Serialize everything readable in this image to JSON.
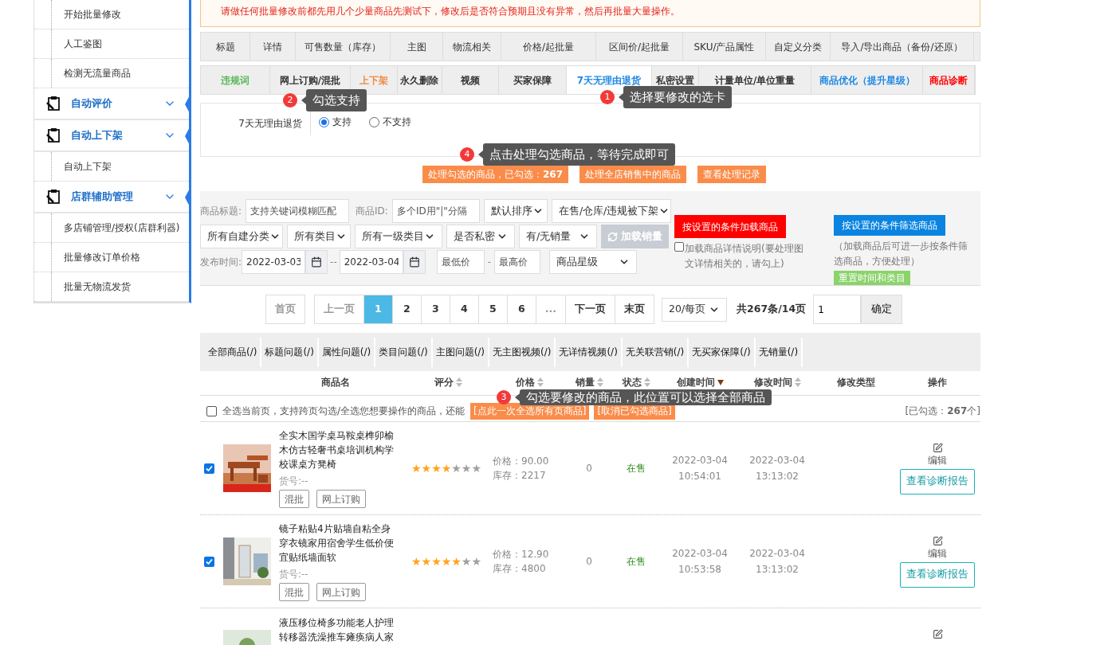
{
  "sidebar": {
    "items": [
      {
        "kind": "item",
        "label": "开始批量修改"
      },
      {
        "kind": "item",
        "label": "人工鉴图"
      },
      {
        "kind": "item",
        "label": "检测无流量商品"
      },
      {
        "kind": "group",
        "label": "自动评价"
      },
      {
        "kind": "group",
        "label": "自动上下架"
      },
      {
        "kind": "item",
        "label": "自动上下架"
      },
      {
        "kind": "group",
        "label": "店群辅助管理"
      },
      {
        "kind": "item",
        "label": "多店铺管理/授权(店群利器)"
      },
      {
        "kind": "item",
        "label": "批量修改订单价格"
      },
      {
        "kind": "item",
        "label": "批量无物流发货"
      }
    ]
  },
  "notice": "请做任何批量修改前都先用几个少量商品先测试下，修改后是否符合预期且没有异常，然后再批量大量操作。",
  "tabs_row_1": [
    {
      "label": "标题",
      "selected": false
    },
    {
      "label": "详情",
      "selected": false
    },
    {
      "label": "可售数量（库存）",
      "selected": false
    },
    {
      "label": "主图",
      "selected": false
    },
    {
      "label": "物流相关",
      "selected": false
    },
    {
      "label": "价格/起批量",
      "selected": false
    },
    {
      "label": "区间价/起批量",
      "selected": false
    },
    {
      "label": "SKU/产品属性",
      "selected": false
    },
    {
      "label": "自定义分类",
      "selected": false
    },
    {
      "label": "导入/导出商品（备份/还原）",
      "selected": false
    }
  ],
  "tabs_row_2": [
    {
      "label": "违规词",
      "selected": false,
      "color": "#5cb85c"
    },
    {
      "label": "网上订购/混批",
      "selected": false,
      "color": "#333333"
    },
    {
      "label": "上下架",
      "selected": false,
      "color": "#f0883e"
    },
    {
      "label": "永久删除",
      "selected": false,
      "color": "#333333"
    },
    {
      "label": "视频",
      "selected": false,
      "color": "#333333"
    },
    {
      "label": "买家保障",
      "selected": false,
      "color": "#333333"
    },
    {
      "label": "7天无理由退货",
      "selected": true,
      "color": "#1e88e5"
    },
    {
      "label": "私密设置",
      "selected": false,
      "color": "#333333"
    },
    {
      "label": "计量单位/单位重量",
      "selected": false,
      "color": "#333333"
    },
    {
      "label": "商品优化（提升星级）",
      "selected": false,
      "color": "#1e88e5"
    },
    {
      "label": "商品诊断",
      "selected": false,
      "color": "#ff0000"
    }
  ],
  "setting": {
    "label": "7天无理由退货",
    "options": [
      {
        "label": "支持",
        "selected": true
      },
      {
        "label": "不支持",
        "selected": false
      }
    ]
  },
  "actions": [
    "处理勾选的商品，已勾选：**267**",
    "处理全店销售中的商品",
    "查看处理记录"
  ],
  "filters": {
    "title_label": "商品标题:",
    "title_placeholder": "支持关键词模糊匹配",
    "id_label": "商品ID:",
    "id_placeholder": "多个ID用\"|\"分隔",
    "selects_row_1": [
      "默认排序",
      "在售/仓库/违规被下架"
    ],
    "selects_row_2": [
      "所有自建分类",
      "所有类目",
      "所有一级类目",
      "是否私密",
      "有/无销量"
    ],
    "load_sales": {
      "label": "加载销量",
      "disabled": true
    },
    "date_label": "发布时间:",
    "date_from": "2022-03-03",
    "date_sep": "--",
    "date_to": "2022-03-04",
    "min_price_placeholder": "最低价",
    "price_sep": "-",
    "max_price_placeholder": "最高价",
    "star_select": "商品星级",
    "load_button": "按设置的条件加载商品",
    "detail_checkbox": {
      "label": "加载商品详情说明(要处理图文详情相关的，请勾上)",
      "checked": false
    },
    "filter_button": "按设置的条件筛选商品",
    "filter_note": "（加载商品后可进一步按条件筛选商品，方便处理）",
    "reset_button": "重置时间和类目"
  },
  "pagination": {
    "pages": [
      {
        "label": "首页",
        "kind": "nav",
        "disabled": true
      },
      {
        "label": "上一页",
        "kind": "nav",
        "disabled": true
      },
      {
        "label": "1",
        "kind": "page",
        "selected": true
      },
      {
        "label": "2",
        "kind": "page",
        "selected": false
      },
      {
        "label": "3",
        "kind": "page",
        "selected": false
      },
      {
        "label": "4",
        "kind": "page",
        "selected": false
      },
      {
        "label": "5",
        "kind": "page",
        "selected": false
      },
      {
        "label": "6",
        "kind": "page",
        "selected": false
      },
      {
        "label": "...",
        "kind": "nav",
        "disabled": true
      },
      {
        "label": "下一页",
        "kind": "nav",
        "disabled": false
      },
      {
        "label": "末页",
        "kind": "nav",
        "disabled": false
      }
    ],
    "page_size": "20/每页",
    "total": "共267条/14页",
    "page_input": "1",
    "go_button": "确定"
  },
  "issue_filters": [
    "全部商品(/)",
    "标题问题(/)",
    "属性问题(/)",
    "类目问题(/)",
    "主图问题(/)",
    "无主图视频(/)",
    "无详情视频(/)",
    "无关联营销(/)",
    "无买家保障(/)",
    "无销量(/)"
  ],
  "table": {
    "columns": [
      {
        "label": "商品名",
        "sortable": false
      },
      {
        "label": "评分",
        "sortable": true,
        "sorted_desc": false
      },
      {
        "label": "价格",
        "sortable": true,
        "sorted_desc": false
      },
      {
        "label": "销量",
        "sortable": true,
        "sorted_desc": false
      },
      {
        "label": "状态",
        "sortable": true,
        "sorted_desc": false
      },
      {
        "label": "创建时间",
        "sortable": true,
        "sorted_desc": true
      },
      {
        "label": "修改时间",
        "sortable": true,
        "sorted_desc": false
      },
      {
        "label": "修改类型",
        "sortable": false
      },
      {
        "label": "操作",
        "sortable": false
      }
    ],
    "select_all": {
      "checked": false,
      "text": "全选当前页，支持跨页勾选/全选您想要操作的商品，还能",
      "buttons": [
        "[点此一次全选所有页商品]",
        "[取消已勾选商品]"
      ],
      "count": "[已勾选：**267**个]"
    },
    "rows": [
      {
        "kind": "full",
        "checked": true,
        "title": "全实木国学桌马鞍桌榫卯榆木仿古轻奢书桌培训机构学校课桌方凳椅",
        "sku": "货号:--",
        "tags": [
          "混批",
          "网上订购"
        ],
        "stars": 4,
        "price": "价格：90.00",
        "stock": "库存：2217",
        "sales": "0",
        "status": "在售",
        "created": [
          "2022-03-04",
          "10:54:01"
        ],
        "modified": [
          "2022-03-04",
          "13:13:02"
        ],
        "edit": "编辑",
        "report": "查看诊断报告"
      },
      {
        "kind": "full",
        "checked": true,
        "title": "镜子粘贴4片贴墙自粘全身穿衣镜家用宿舍学生低价便宜贴纸墙面软",
        "sku": "货号:--",
        "tags": [
          "混批",
          "网上订购"
        ],
        "stars": 5,
        "price": "价格：12.90",
        "stock": "库存：4800",
        "sales": "0",
        "status": "在售",
        "created": [
          "2022-03-04",
          "10:53:58"
        ],
        "modified": [
          "2022-03-04",
          "13:13:02"
        ],
        "edit": "编辑",
        "report": "查看诊断报告"
      },
      {
        "kind": "partial",
        "title": "液压移位椅多功能老人护理转移器洗澡推车瘫痪病人家"
      }
    ]
  },
  "callouts": [
    {
      "number": "2",
      "text": "勾选支持"
    },
    {
      "number": "1",
      "text": "选择要修改的选卡"
    },
    {
      "number": "4",
      "text": "点击处理勾选商品，等待完成即可"
    },
    {
      "number": "3",
      "text": "勾选要修改的商品，此位置可以选择全部商品"
    }
  ]
}
